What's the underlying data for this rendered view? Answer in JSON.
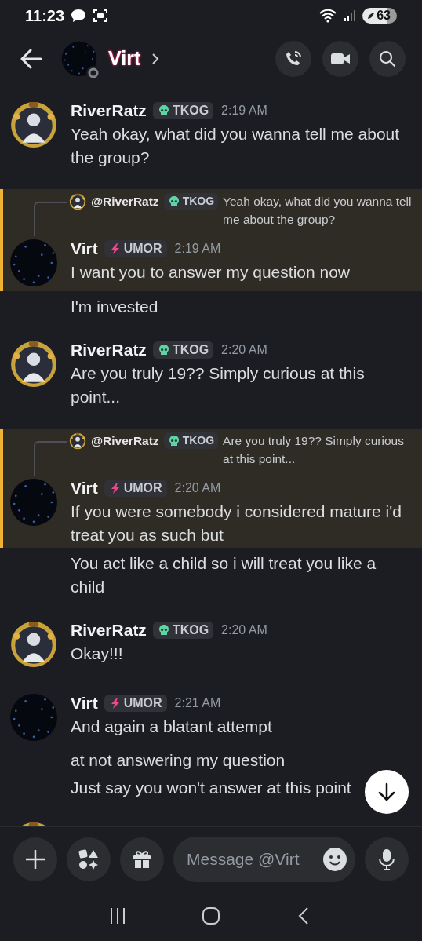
{
  "status_bar": {
    "time": "11:23",
    "battery": "63"
  },
  "header": {
    "name": "Virt",
    "online": false
  },
  "messages": [
    {
      "kind": "friend",
      "author": "RiverRatz",
      "badge": {
        "kind": "skull",
        "label": "TKOG"
      },
      "time": "2:19 AM",
      "mentioned": false,
      "lines": [
        "Yeah okay, what did you wanna tell me about the group?"
      ]
    },
    {
      "kind": "self",
      "author": "Virt",
      "badge": {
        "kind": "bolt",
        "label": "UMOR"
      },
      "time": "2:19 AM",
      "mentioned": true,
      "reply": {
        "author": "@RiverRatz",
        "badge": {
          "kind": "skull",
          "label": "TKOG"
        },
        "text": "Yeah okay, what did you wanna tell me about the group?"
      },
      "lines": [
        "I want you to answer my question now"
      ],
      "followups": [
        "I'm invested"
      ]
    },
    {
      "kind": "friend",
      "author": "RiverRatz",
      "badge": {
        "kind": "skull",
        "label": "TKOG"
      },
      "time": "2:20 AM",
      "mentioned": false,
      "lines": [
        "Are you truly 19?? Simply curious at this point..."
      ]
    },
    {
      "kind": "self",
      "author": "Virt",
      "badge": {
        "kind": "bolt",
        "label": "UMOR"
      },
      "time": "2:20 AM",
      "mentioned": true,
      "reply": {
        "author": "@RiverRatz",
        "badge": {
          "kind": "skull",
          "label": "TKOG"
        },
        "text": "Are you truly 19?? Simply curious at this point..."
      },
      "lines": [
        "If you were somebody i considered mature i'd treat you as such but"
      ],
      "followups": [
        "You act like a child so i will treat you like a child"
      ]
    },
    {
      "kind": "friend",
      "author": "RiverRatz",
      "badge": {
        "kind": "skull",
        "label": "TKOG"
      },
      "time": "2:20 AM",
      "mentioned": false,
      "lines": [
        "Okay!!!"
      ]
    },
    {
      "kind": "self",
      "author": "Virt",
      "badge": {
        "kind": "bolt",
        "label": "UMOR"
      },
      "time": "2:21 AM",
      "mentioned": false,
      "lines": [
        "And again a blatant attempt"
      ],
      "followups": [
        "at not answering my question",
        "Just say you won't answer at this point"
      ]
    },
    {
      "kind": "friend"
    }
  ],
  "composer": {
    "placeholder": "Message @Virt"
  }
}
